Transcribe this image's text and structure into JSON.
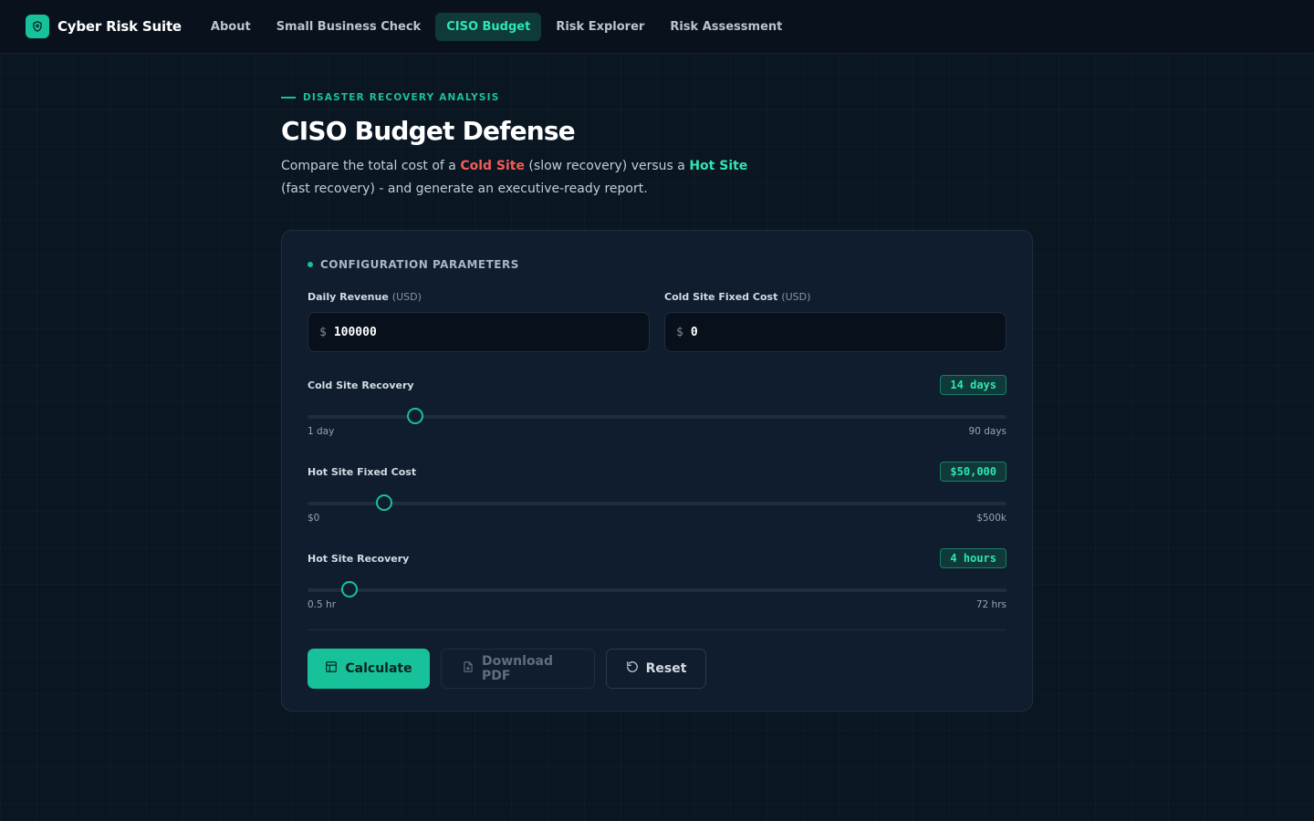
{
  "nav": {
    "brand": "Cyber Risk Suite",
    "links": [
      {
        "label": "About",
        "active": false
      },
      {
        "label": "Small Business Check",
        "active": false
      },
      {
        "label": "CISO Budget",
        "active": true
      },
      {
        "label": "Risk Explorer",
        "active": false
      },
      {
        "label": "Risk Assessment",
        "active": false
      }
    ]
  },
  "header": {
    "eyebrow": "DISASTER RECOVERY ANALYSIS",
    "title": "CISO Budget Defense",
    "desc_prefix": "Compare the total cost of a ",
    "desc_cold": "Cold Site",
    "desc_middle": " (slow recovery) versus a ",
    "desc_hot": "Hot Site",
    "desc_suffix": " (fast recovery) - and generate an executive-ready report."
  },
  "config": {
    "section_title": "CONFIGURATION PARAMETERS",
    "daily_revenue": {
      "label": "Daily Revenue",
      "unit": "(USD)",
      "currency": "$",
      "value": "100000"
    },
    "cold_fixed": {
      "label": "Cold Site Fixed Cost",
      "unit": "(USD)",
      "currency": "$",
      "value": "0"
    },
    "sliders": [
      {
        "label": "Cold Site Recovery",
        "badge": "14 days",
        "min_label": "1 day",
        "max_label": "90 days",
        "fraction": 0.154
      },
      {
        "label": "Hot Site Fixed Cost",
        "badge": "$50,000",
        "min_label": "$0",
        "max_label": "$500k",
        "fraction": 0.11
      },
      {
        "label": "Hot Site Recovery",
        "badge": "4 hours",
        "min_label": "0.5 hr",
        "max_label": "72 hrs",
        "fraction": 0.06
      }
    ]
  },
  "actions": {
    "calculate": "Calculate",
    "download": "Download PDF",
    "reset": "Reset"
  },
  "colors": {
    "accent": "#17c29a",
    "cold": "#f25c54",
    "hot": "#2ee6b3"
  }
}
